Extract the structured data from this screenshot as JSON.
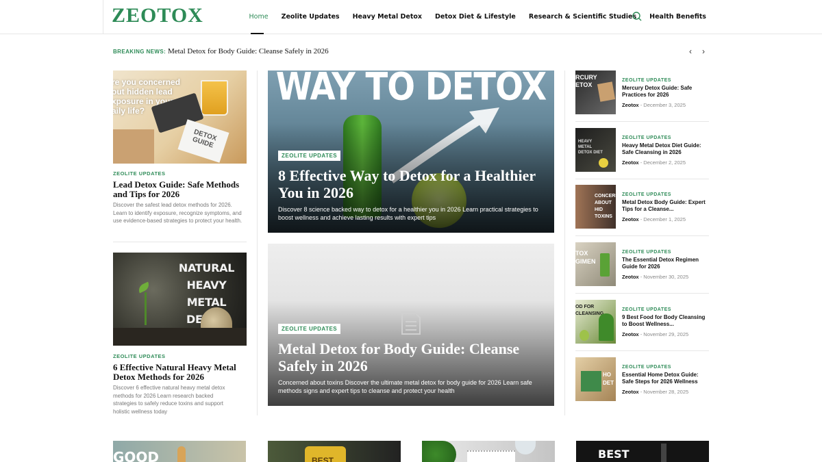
{
  "header": {
    "logo": "ZEOTOX",
    "nav": [
      "Home",
      "Zeolite Updates",
      "Heavy Metal Detox",
      "Detox Diet & Lifestyle",
      "Research & Scientific Studies",
      "Health Benefits"
    ]
  },
  "breaking": {
    "label": "BREAKING NEWS:",
    "title": "Metal Detox for Body Guide: Cleanse Safely in 2026",
    "prev": "‹",
    "next": "›"
  },
  "left": [
    {
      "thumb_text": "re you concerned\nout hidden lead\nxposure in your\naily life?",
      "badge": "DETOX\nGUIDE",
      "category": "ZEOLITE UPDATES",
      "title": "Lead Detox Guide: Safe Methods and Tips for 2026",
      "excerpt": "Discover the safest lead detox methods for 2026. Learn to identify exposure, recognize symptoms, and use evidence-based strategies to protect your health."
    },
    {
      "thumb_text": "NATURAL\nHEAVY METAL\nDETOX",
      "category": "ZEOLITE UPDATES",
      "title": "6 Effective Natural Heavy Metal Detox Methods for 2026",
      "excerpt": "Discover 6 effective natural heavy metal detox methods for 2026 Learn research backed strategies to safely reduce toxins and support holistic wellness today"
    }
  ],
  "featured": [
    {
      "image_text": "WAY TO DETOX",
      "tag": "ZEOLITE UPDATES",
      "title": "8 Effective Way to Detox for a Healthier You in 2026",
      "excerpt": "Discover 8 science backed way to detox for a healthier you in 2026 Learn practical strategies to boost wellness and achieve lasting results with expert tips"
    },
    {
      "tag": "ZEOLITE UPDATES",
      "title": "Metal Detox for Body Guide: Cleanse Safely in 2026",
      "excerpt": "Concerned about toxins Discover the ultimate metal detox for body guide for 2026 Learn safe methods signs and expert tips to cleanse and protect your health"
    }
  ],
  "sidebar": [
    {
      "thumb_text": "RCURY\nETOX",
      "category": "ZEOLITE UPDATES",
      "title": "Mercury Detox Guide: Safe Practices for 2026",
      "author": "Zeotox",
      "date": "December 3, 2025"
    },
    {
      "thumb_text": "HEAVY\nMETAL\nDETOX DIET",
      "category": "ZEOLITE UPDATES",
      "title": "Heavy Metal Detox Diet Guide: Safe Cleansing in 2026",
      "author": "Zeotox",
      "date": "December 2, 2025"
    },
    {
      "thumb_text": "CONCERN\nABOUT HID\nTOXINS",
      "category": "ZEOLITE UPDATES",
      "title": "Metal Detox Body Guide: Expert Tips for a Cleanse...",
      "author": "Zeotox",
      "date": "December 1, 2025"
    },
    {
      "thumb_text": "TOX\nGIMEN",
      "category": "ZEOLITE UPDATES",
      "title": "The Essential Detox Regimen Guide for 2026",
      "author": "Zeotox",
      "date": "November 30, 2025"
    },
    {
      "thumb_text": "OD FOR\nCLEANSING",
      "category": "ZEOLITE UPDATES",
      "title": "9 Best Food for Body Cleansing to Boost Wellness...",
      "author": "Zeotox",
      "date": "November 29, 2025"
    },
    {
      "thumb_text": "HO\nDET",
      "category": "ZEOLITE UPDATES",
      "title": "Essential Home Detox Guide: Safe Steps for 2026 Wellness",
      "author": "Zeotox",
      "date": "November 28, 2025"
    }
  ],
  "bottom": [
    {
      "thumb_text": "GOOD"
    },
    {
      "thumb_text": "BEST"
    },
    {
      "thumb_text": ""
    },
    {
      "thumb_text": "BEST"
    }
  ],
  "meta_sep": "-",
  "colors": {
    "accent": "#2e8b57"
  }
}
